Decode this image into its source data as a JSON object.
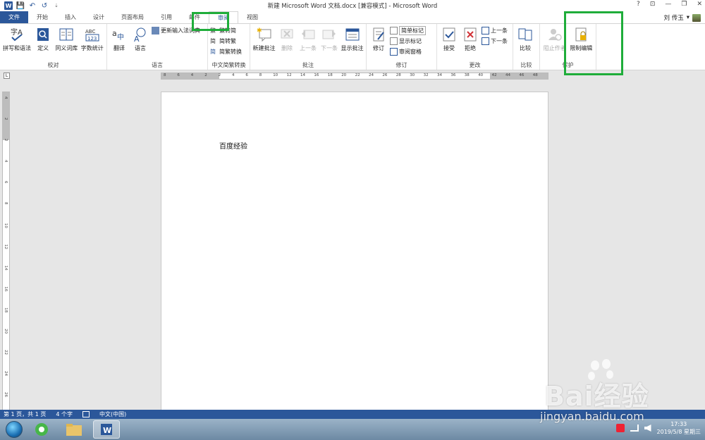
{
  "window": {
    "title": "新建 Microsoft Word 文档.docx [兼容模式] - Microsoft Word",
    "help": "?",
    "ribbon_display": "⊡",
    "minimize": "—",
    "restore": "❐",
    "close": "✕"
  },
  "qat": {
    "app_icon": "W",
    "save": "💾",
    "undo": "↶",
    "redo": "↺",
    "customize": "⇣"
  },
  "tabs": [
    {
      "label": "文件"
    },
    {
      "label": "开始"
    },
    {
      "label": "插入"
    },
    {
      "label": "设计"
    },
    {
      "label": "页面布局"
    },
    {
      "label": "引用"
    },
    {
      "label": "邮件"
    },
    {
      "label": "审阅"
    },
    {
      "label": "视图"
    }
  ],
  "user": {
    "name": "刘 传玉",
    "dropdown": "▾"
  },
  "ribbon": {
    "proofing": {
      "label": "校对",
      "spelling": "拼写和语法",
      "define": "定义",
      "thesaurus": "同义词库",
      "word_count": "字数统计"
    },
    "language": {
      "label": "语言",
      "translate": "翻译",
      "language": "语言",
      "update_ime": "更新输入法词典"
    },
    "chinese": {
      "label": "中文简繁转换",
      "to_simplified": "繁转简",
      "to_traditional": "简转繁",
      "convert": "简繁转换"
    },
    "comments": {
      "label": "批注",
      "new": "新建批注",
      "delete": "删除",
      "previous": "上一条",
      "next": "下一条",
      "show": "显示批注"
    },
    "tracking": {
      "label": "修订",
      "track": "修订",
      "simple_markup": "简单标记",
      "show_markup": "显示标记",
      "reviewing_pane": "审阅窗格"
    },
    "changes": {
      "label": "更改",
      "accept": "接受",
      "reject": "拒绝",
      "previous": "上一条",
      "next": "下一条"
    },
    "compare": {
      "label": "比较",
      "compare": "比较"
    },
    "protect": {
      "label": "保护",
      "block_authors": "阻止作者",
      "restrict_editing": "限制编辑"
    }
  },
  "ruler": {
    "corner": "L",
    "h_ticks": [
      "8",
      "6",
      "4",
      "2",
      "2",
      "4",
      "6",
      "8",
      "10",
      "12",
      "14",
      "16",
      "18",
      "20",
      "22",
      "24",
      "26",
      "28",
      "30",
      "32",
      "34",
      "36",
      "38",
      "40",
      "42",
      "44",
      "46",
      "48"
    ],
    "v_ticks": [
      "4",
      "2",
      "2",
      "4",
      "6",
      "8",
      "10",
      "12",
      "14",
      "16",
      "18",
      "20",
      "22",
      "24",
      "26"
    ]
  },
  "document": {
    "text": "百度经验"
  },
  "status": {
    "page": "第 1 页，共 1 页",
    "words": "4 个字",
    "language": "中文(中国)"
  },
  "taskbar": {
    "time": "17:33",
    "date": "2019/5/8 星期三"
  },
  "watermark": {
    "brand": "Bai经验",
    "url": "jingyan.baidu.com"
  }
}
